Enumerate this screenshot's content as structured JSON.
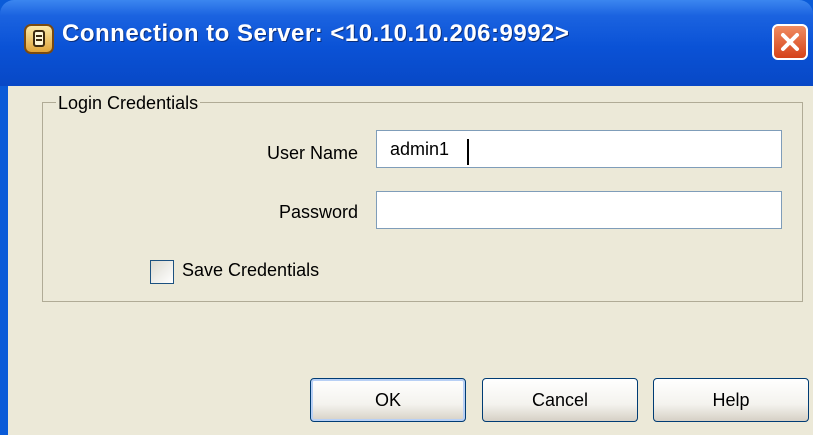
{
  "window": {
    "title": "Connection to Server: <10.10.10.206:9992>",
    "icon": "server-connection-icon",
    "close_icon": "close-icon"
  },
  "group": {
    "label": "Login Credentials"
  },
  "fields": {
    "username": {
      "label": "User Name",
      "value": "admin1",
      "placeholder": ""
    },
    "password": {
      "label": "Password",
      "value": "",
      "placeholder": ""
    }
  },
  "save_credentials": {
    "label": "Save Credentials",
    "checked": false
  },
  "buttons": {
    "ok": "OK",
    "cancel": "Cancel",
    "help": "Help"
  },
  "colors": {
    "titlebar": "#0a52d6",
    "dialog_background": "#ece9d8",
    "close_button": "#d5421a",
    "input_border": "#7f9db9"
  }
}
